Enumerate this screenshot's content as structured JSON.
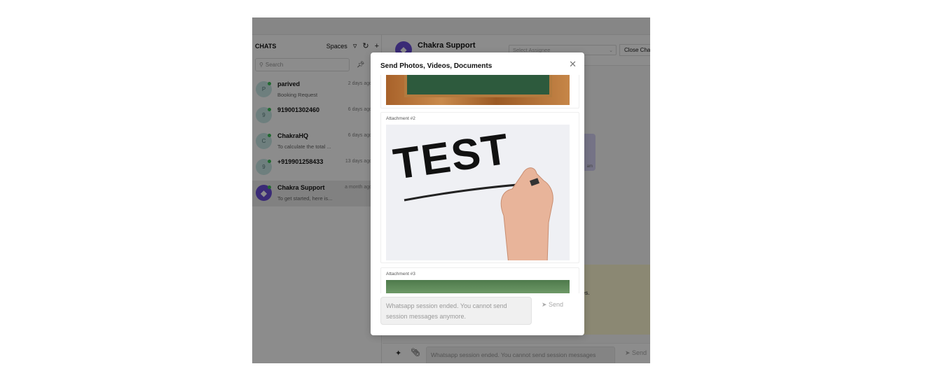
{
  "sidebar": {
    "title": "CHATS",
    "spaces_label": "Spaces",
    "search_placeholder": "Search",
    "chats": [
      {
        "initial": "P",
        "name": "parived",
        "time": "2 days ago",
        "preview": "Booking Request"
      },
      {
        "initial": "9",
        "name": "919001302460",
        "time": "6 days ago",
        "preview": ""
      },
      {
        "initial": "C",
        "name": "ChakraHQ",
        "time": "6 days ago",
        "preview": "To calculate the total ..."
      },
      {
        "initial": "9",
        "name": "+919901258433",
        "time": "13 days ago",
        "preview": ""
      },
      {
        "initial": "",
        "name": "Chakra Support",
        "time": "a month ago",
        "preview": "To get started, here is..."
      }
    ]
  },
  "main": {
    "title": "Chakra Support",
    "assignee_placeholder": "Select Assignee",
    "close_chat_label": "Close Chat",
    "notice_text": "…4 hours of their last …ges.",
    "composer_placeholder": "Whatsapp session ended. You cannot send session messages anymore.",
    "send_label": "Send"
  },
  "modal": {
    "title": "Send Photos, Videos, Documents",
    "attachments": [
      {
        "label": "Attachment #2",
        "image": "test-hand-marker"
      },
      {
        "label": "Attachment #3",
        "image": "green-texture"
      }
    ],
    "input_placeholder": "Whatsapp session ended. You cannot send session messages anymore.",
    "send_label": "Send"
  }
}
